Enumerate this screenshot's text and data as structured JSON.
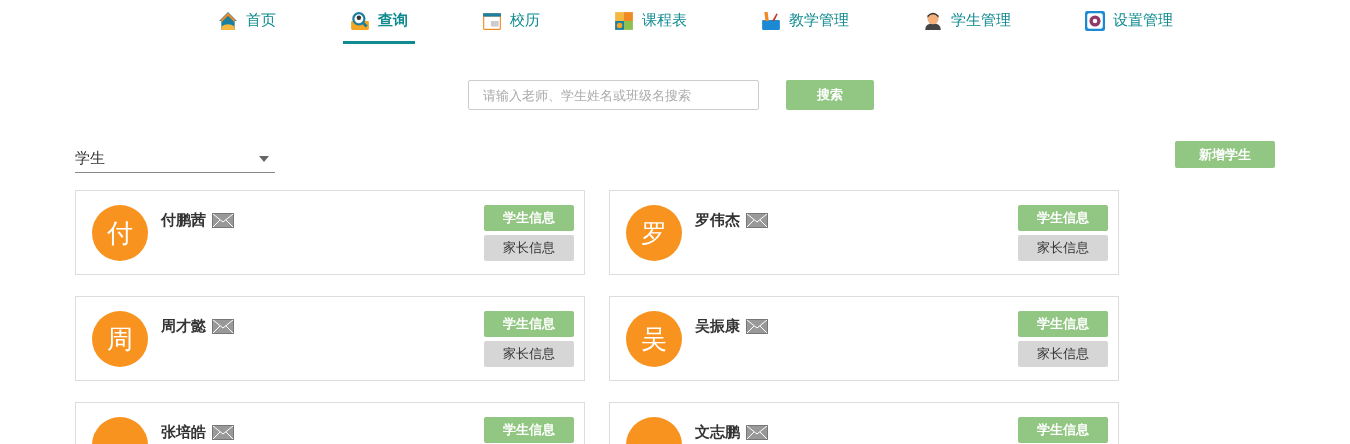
{
  "nav": [
    {
      "label": "首页",
      "selected": false
    },
    {
      "label": "查询",
      "selected": true
    },
    {
      "label": "校历",
      "selected": false
    },
    {
      "label": "课程表",
      "selected": false
    },
    {
      "label": "教学管理",
      "selected": false
    },
    {
      "label": "学生管理",
      "selected": false
    },
    {
      "label": "设置管理",
      "selected": false
    }
  ],
  "search": {
    "placeholder": "请输入老师、学生姓名或班级名搜索",
    "button": "搜索"
  },
  "filter": {
    "value": "学生"
  },
  "add_button": "新增学生",
  "students": [
    {
      "avatar": "付",
      "name": "付鹏茜",
      "buttons": [
        "学生信息",
        "家长信息"
      ]
    },
    {
      "avatar": "罗",
      "name": "罗伟杰",
      "buttons": [
        "学生信息",
        "家长信息"
      ]
    },
    {
      "avatar": "周",
      "name": "周才懿",
      "buttons": [
        "学生信息",
        "家长信息"
      ]
    },
    {
      "avatar": "吴",
      "name": "吴振康",
      "buttons": [
        "学生信息",
        "家长信息"
      ]
    },
    {
      "name": "张培皓",
      "buttons": [
        "学生信息"
      ]
    },
    {
      "name": "文志鹏",
      "buttons": [
        "学生信息"
      ]
    }
  ]
}
